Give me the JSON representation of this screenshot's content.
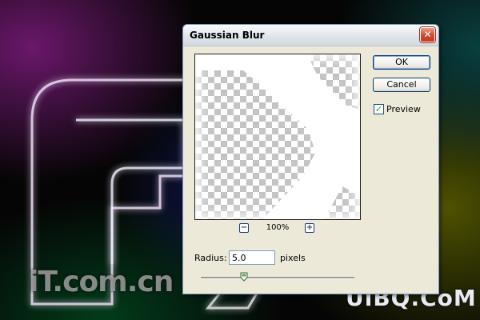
{
  "dialog": {
    "title": "Gaussian Blur",
    "close_symbol": "✕",
    "ok_label": "OK",
    "cancel_label": "Cancel",
    "preview_label": "Preview",
    "preview_checked": true,
    "zoom_out_symbol": "−",
    "zoom_in_symbol": "+",
    "zoom_level": "100%",
    "radius_label": "Radius:",
    "radius_value": "5.0",
    "units_label": "pixels",
    "slider_fraction": 0.28
  },
  "background": {
    "letter": "F",
    "watermark_left": "iT.com.cn",
    "watermark_right": "UiBQ.CoM"
  },
  "colors": {
    "dialog_face": "#ece9d8",
    "close_button": "#d0492d",
    "button_border": "#003c74"
  }
}
